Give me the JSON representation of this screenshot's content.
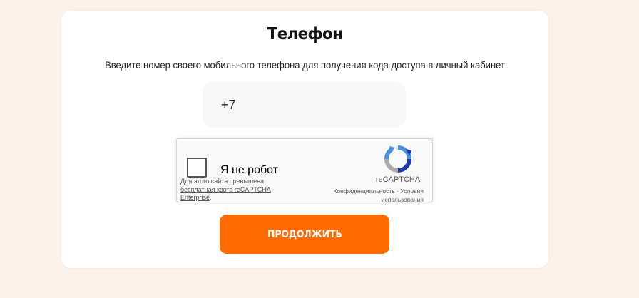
{
  "form": {
    "title": "Телефон",
    "subtitle": "Введите номер своего мобильного телефона для получения кода доступа в личный кабинет",
    "phone_value": "+7",
    "submit_label": "ПРОДОЛЖИТЬ"
  },
  "recaptcha": {
    "checkbox_label": "Я не робот",
    "brand": "reCAPTCHA",
    "privacy_link": "Конфиденциальность",
    "separator": " - ",
    "terms_link": "Условия использования",
    "quota_text": "Для этого сайта превышена",
    "quota_link_1": "бесплатная квота reCAPTCHA",
    "quota_link_2": "Enterprise",
    "quota_end": "."
  },
  "colors": {
    "page_background": "#fcf2ea",
    "card_background": "#ffffff",
    "accent": "#ff6b00",
    "input_background": "#f8f8f8"
  },
  "icons": {
    "recaptcha_logo": "recaptcha-logo-icon"
  }
}
